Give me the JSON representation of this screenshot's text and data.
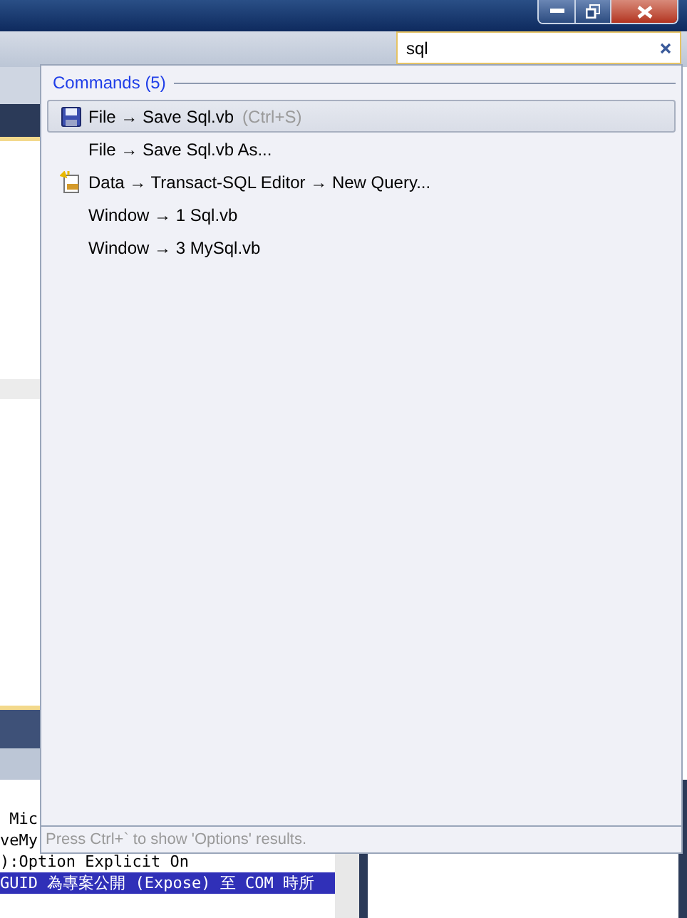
{
  "search": {
    "value": "sql"
  },
  "results": {
    "heading": "Commands (5)",
    "items": [
      {
        "kind": "save",
        "label": "File → Save Sql.vb",
        "shortcut": "(Ctrl+S)",
        "selected": true
      },
      {
        "kind": "plain",
        "label": "File → Save Sql.vb As...",
        "selected": false
      },
      {
        "kind": "query",
        "label": "Data → Transact-SQL Editor → New Query...",
        "selected": false
      },
      {
        "kind": "plain",
        "label": "Window → 1 Sql.vb",
        "selected": false
      },
      {
        "kind": "plain",
        "label": "Window → 3 MySql.vb",
        "selected": false
      }
    ],
    "footer": "Press Ctrl+` to show 'Options' results."
  },
  "editor": {
    "lines": [
      {
        "text": " Mic",
        "selected": false
      },
      {
        "text": "veMy",
        "selected": false
      },
      {
        "text": "):Option Explicit On",
        "selected": false
      },
      {
        "text": "GUID 為專案公開 (Expose) 至 COM 時所",
        "selected": true
      }
    ]
  }
}
